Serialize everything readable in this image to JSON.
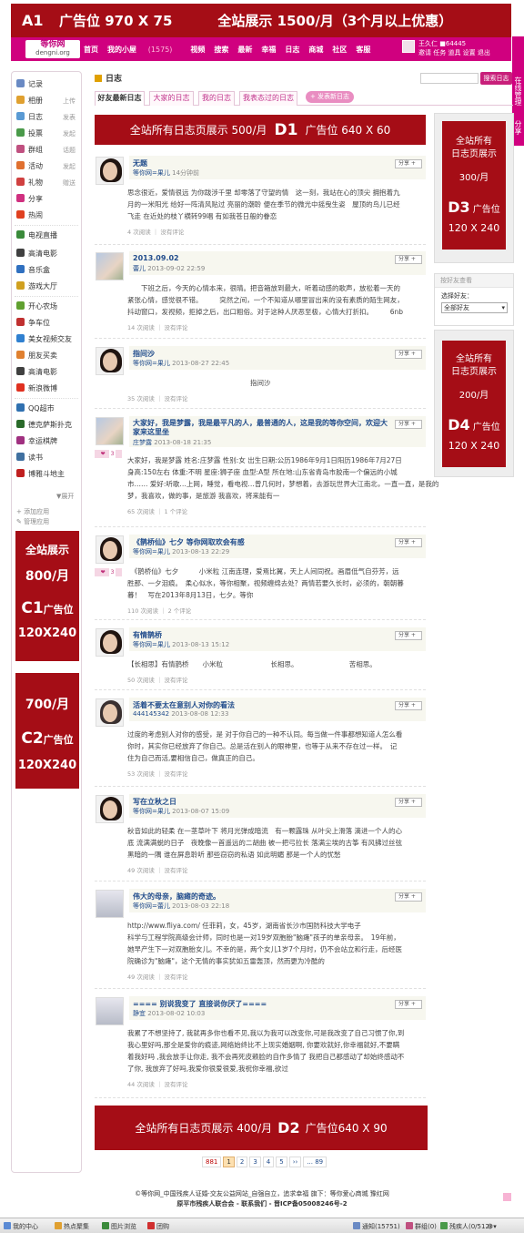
{
  "top_ad": {
    "code": "A1",
    "slot": "广告位 970 X 75",
    "promo": "全站展示 1500/月（3个月以上优惠）"
  },
  "logo": {
    "cn": "等你网",
    "domain": "dengni.org"
  },
  "nav": {
    "items": [
      "首页",
      "我的小屋",
      "视频",
      "搜索",
      "最新",
      "幸福",
      "日志",
      "商城",
      "社区",
      "客服"
    ],
    "home_count": "(1575)"
  },
  "user": {
    "name": "王久仁",
    "id": "64445",
    "links": "邀请 任务 道具 设置 退出"
  },
  "side_tab": {
    "label1": "在线管理",
    "label2": "分享"
  },
  "sidebar": {
    "items": [
      {
        "label": "记录",
        "sub": "",
        "color": "#6a8ac4"
      },
      {
        "label": "相册",
        "sub": "上传",
        "color": "#e0a030"
      },
      {
        "label": "日志",
        "sub": "发表",
        "color": "#5a9ad4"
      },
      {
        "label": "投票",
        "sub": "发起",
        "color": "#4a9a4a"
      },
      {
        "label": "群组",
        "sub": "话题",
        "color": "#c05080"
      },
      {
        "label": "活动",
        "sub": "发起",
        "color": "#e07030"
      },
      {
        "label": "礼物",
        "sub": "赠送",
        "color": "#d04040"
      },
      {
        "label": "分享",
        "sub": "",
        "color": "#d03080"
      },
      {
        "label": "热闹",
        "sub": "",
        "color": "#e04020"
      },
      {
        "label": "电视直播",
        "sub": "",
        "color": "#3a8a3a"
      },
      {
        "label": "高清电影",
        "sub": "",
        "color": "#404040"
      },
      {
        "label": "音乐盒",
        "sub": "",
        "color": "#3070c0"
      },
      {
        "label": "游戏大厅",
        "sub": "",
        "color": "#d0a020"
      },
      {
        "label": "开心农场",
        "sub": "",
        "color": "#60a030"
      },
      {
        "label": "争车位",
        "sub": "",
        "color": "#c03030"
      },
      {
        "label": "美女视频交友",
        "sub": "",
        "color": "#3080d0"
      },
      {
        "label": "朋友买卖",
        "sub": "",
        "color": "#e08030"
      },
      {
        "label": "高清电影",
        "sub": "",
        "color": "#404040"
      },
      {
        "label": "新浪微博",
        "sub": "",
        "color": "#e03020"
      },
      {
        "label": "QQ超市",
        "sub": "",
        "color": "#3070b0"
      },
      {
        "label": "德克萨斯扑克",
        "sub": "",
        "color": "#2a6a2a"
      },
      {
        "label": "幸运棋牌",
        "sub": "",
        "color": "#a03080"
      },
      {
        "label": "读书",
        "sub": "",
        "color": "#4070a0"
      },
      {
        "label": "博雅斗地主",
        "sub": "",
        "color": "#c02020"
      }
    ],
    "expand": "▼展开",
    "add_app": "添加应用",
    "manage_app": "管理应用"
  },
  "c1_ad": {
    "line1": "全站展示",
    "line2": "800/月",
    "code": "C1",
    "slot": "广告位",
    "size": "120X240"
  },
  "c2_ad": {
    "line1": "700/月",
    "code": "C2",
    "slot": "广告位",
    "size": "120X240"
  },
  "page": {
    "title": "日志",
    "search_button": "搜索日志"
  },
  "tabs": [
    "好友最新日志",
    "大家的日志",
    "我的日志",
    "我表态过的日志"
  ],
  "publish_button": "+ 发表新日志",
  "d1_ad": {
    "pre": "全站所有日志页展示 500/月",
    "code": "D1",
    "slot": "广告位 640 X 60"
  },
  "d2_ad": {
    "pre": "全站所有日志页展示 400/月",
    "code": "D2",
    "slot": "广告位640 X 90"
  },
  "d3_ad": {
    "l1": "全站所有",
    "l2": "日志页展示",
    "price": "300/月",
    "code": "D3",
    "slot": "广告位",
    "size": "120 X 240"
  },
  "d4_ad": {
    "l1": "全站所有",
    "l2": "日志页展示",
    "price": "200/月",
    "code": "D4",
    "slot": "广告位",
    "size": "120 X 240"
  },
  "friend_box": {
    "header": "按好友查看",
    "label": "选择好友：",
    "select": "全部好友"
  },
  "share_label": "分享 +",
  "posts": [
    {
      "title": "无题",
      "user": "等你网=果儿",
      "time": "14分钟前",
      "body": [
        "思念很近，爱情很远 为你跋涉千里 却零落了守望的情　这一刻，我站在心的顶尖 拥抱着九",
        "月的一米阳光 给好一阵清风贴过 亮丽的潮聆 便在季节的微光中摇曳生姿　屋顶的鸟儿已经",
        "飞走 在近处的枝丫横转99唱 有如我苍日般的眷恋"
      ],
      "foot": "4 次阅读 ｜ 没有评论",
      "badge": ""
    },
    {
      "title": "2013.09.02",
      "user": "蕾儿",
      "time": "2013-09-02 22:59",
      "body": [
        "　　下班之后，今天的心情本来，很晴。把音箱放到最大，听着动感的歌声，放松着一天的",
        "紧张心情，感觉很不错。　　　突然之间，一个不知道从哪里冒出来的没有素质的陌生网友，",
        "抖动窗口，发视频，拒掉之后，出口粗俗。对于这种人厌恶至极，心情大打折扣。　　　6nb"
      ],
      "foot": "14 次阅读 ｜ 没有评论",
      "badge": ""
    },
    {
      "title": "指间沙",
      "user": "等你网=果儿",
      "time": "2013-08-27 22:45",
      "body": [
        "　　　　　　　　　　　　　　　　　　指间沙"
      ],
      "foot": "35 次阅读 ｜ 没有评论",
      "badge": ""
    },
    {
      "title": "大家好，我是梦露，我是最平凡的人，最普通的人，这是我的等你空间，欢迎大家来这里坐",
      "user": "庄梦露",
      "time": "2013-08-18 21:35",
      "body": [
        "大家好，我是梦露 姓名:庄梦露 性别:女 出生日期:公历1986年9月1日阳历1986年7月27日",
        "身高:150左右 体重:不明 星座:狮子座 血型:A型 所在地:山东省青岛市胶南一个偏远的小城",
        "市…… 爱好:听歌…上网，睡觉，看电视…曾几何时，梦想着，去游玩世界大江南北，一直一直，是我的",
        "梦，我喜欢，做的事，是旅游 我喜欢，将来能有一"
      ],
      "foot": "65 次阅读 ｜ 1 个评论",
      "badge": "3"
    },
    {
      "title": "《鹊桥仙》七夕 等你网取欢会有感",
      "user": "等你网=果儿",
      "time": "2013-08-13 22:29",
      "body": [
        "　《鹊桥仙》七夕　　　小米粒 江南连理，爱焉比翼，天上人间同祝。画眉低气自芬芳，远",
        "胜那、一夕泪痕。　柔心似水，等你相聚，视频缠绵去处？两情若要久长时，必须的，朝朝暮",
        "暮！　写在2013年8月13日，七夕。等你"
      ],
      "foot": "110 次阅读 ｜ 2 个评论",
      "badge": "3"
    },
    {
      "title": "有情鹊桥",
      "user": "等你网=果儿",
      "time": "2013-08-13 15:12",
      "body": [
        "【长相思】有情鹊桥　　小米粒　　　　　　　长相思。　　　　　　　　苦相思。"
      ],
      "foot": "50 次阅读 ｜ 没有评论",
      "badge": ""
    },
    {
      "title": "活着不要太在意别人对你的看法",
      "user": "444145342",
      "time": "2013-08-08 12:33",
      "body": [
        "过度的考虑别人对你的感受，是 对于你自己的一种不认同。每当做一件事都想知道人怎么看",
        "你时，其实你已经放弃了你自己。总是活在别人的眼神里，也等于从来不存在过一样。　记",
        "住为自己而活,要相信自己，做真正的自己。"
      ],
      "foot": "53 次阅读 ｜ 没有评论",
      "badge": ""
    },
    {
      "title": "写在立秋之日",
      "user": "等你网=果儿",
      "time": "2013-08-07 15:09",
      "body": [
        "秋音如此的轻柔 在一茎草叶下 将月光弹成暗流　有一颗露珠 从叶尖上滑落 滴进一个人的心",
        "底 流满满蜕的日子　夜晚像一首遥远的二胡曲 被一把弓拉长 落满尘埃的古筝 有风拂过丝弦",
        "黑暗的一隅 谁在屏息聆听 那些窃窃的私语 如此明媚 那是一个人的忧愁"
      ],
      "foot": "49 次阅读 ｜ 没有评论",
      "badge": ""
    },
    {
      "title": "伟大的母亲，脑瘫的奇迹。",
      "user": "等你网=蕾儿",
      "time": "2013-08-03 22:18",
      "body": [
        "http://www.fliya.com/ 任菲莉，女，45岁，湖南省长沙市国防科技大学电子",
        "科学与工程学院高级会计师，同时也是一对19岁双胞胎\"脑瘫\"孩子的单亲母亲。　19年前，",
        "她早产生下一对双胞胎女儿。不幸的是，两个女儿1岁7个月时，仍不会站立和行走，后经医",
        "院确诊为\"脑瘫\"，这个无情的事实犹如五雷轰顶，然而更为冷酷的"
      ],
      "foot": "49 次阅读 ｜ 没有评论",
      "badge": ""
    },
    {
      "title": "==== 别说我变了 直接说你厌了====",
      "user": "静宜",
      "time": "2013-08-02 10:03",
      "body": [
        "我累了不想坚持了, 我就再多你也看不见,我以为我可以改变你,可是我改变了自己习惯了你,到",
        "我心里好吗,那全是爱你的痕迹,网络始终比不上现实婚姻啊, 你要欢就好,你幸福就好,不要瞒",
        "着我好吗 ,我会放手让你走, 我不会再死皮赖脸的自作多情了 我把自己都感动了却始终感动不",
        "了你, 我放弃了好吗,我爱你很爱很爱,我祝你幸福,欲过"
      ],
      "foot": "44 次阅读 ｜ 没有评论",
      "badge": ""
    }
  ],
  "pager": {
    "total": "881",
    "pages": [
      "1",
      "2",
      "3",
      "4",
      "5",
      "››",
      "... 89"
    ]
  },
  "footer": {
    "line1": "©等你网_中国残疾人证婚·交友公益网站_自强自立，追求幸福 旗下：等你爱心商城 豫红网",
    "line2": "原平市残疾人联合会 - 联系我们 - 晋ICP备05008246号-2"
  },
  "taskbar": {
    "items": [
      "我的中心",
      "热点聚集",
      "图片浏览",
      "团购"
    ],
    "right": [
      "通知(15751)",
      "群组(0)",
      "残疾人(0/512)"
    ]
  }
}
